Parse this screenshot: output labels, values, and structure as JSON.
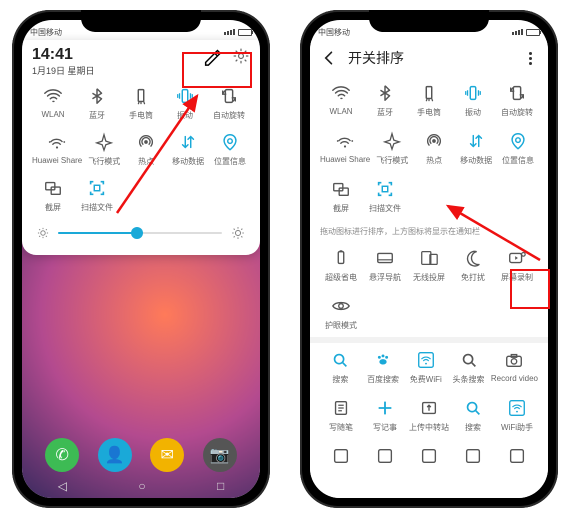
{
  "status": {
    "carrier_left": "中国移动",
    "carrier_right": "中国移动"
  },
  "left": {
    "time": "14:41",
    "date": "1月19日 星期日",
    "row1": [
      {
        "name": "wlan",
        "label": "WLAN",
        "active": false
      },
      {
        "name": "bluetooth",
        "label": "蓝牙",
        "active": false
      },
      {
        "name": "flashlight",
        "label": "手电筒",
        "active": false
      },
      {
        "name": "vibrate",
        "label": "振动",
        "active": true
      },
      {
        "name": "autorotate",
        "label": "自动旋转",
        "active": false
      }
    ],
    "row2": [
      {
        "name": "huaweishare",
        "label": "Huawei Share",
        "active": false
      },
      {
        "name": "airplane",
        "label": "飞行模式",
        "active": false
      },
      {
        "name": "hotspot",
        "label": "热点",
        "active": false
      },
      {
        "name": "mobiledata",
        "label": "移动数据",
        "active": true
      },
      {
        "name": "location",
        "label": "位置信息",
        "active": true
      }
    ],
    "row3": [
      {
        "name": "screenshot",
        "label": "截屏",
        "active": false
      },
      {
        "name": "scan",
        "label": "扫描文件",
        "active": true
      }
    ],
    "dock": [
      {
        "name": "phone",
        "color": "#3dbb54"
      },
      {
        "name": "contacts",
        "color": "#1aa9d8"
      },
      {
        "name": "messages",
        "color": "#f2b300"
      },
      {
        "name": "camera",
        "color": "#555"
      }
    ]
  },
  "right": {
    "title": "开关排序",
    "row1": [
      {
        "name": "wlan",
        "label": "WLAN",
        "active": false
      },
      {
        "name": "bluetooth",
        "label": "蓝牙",
        "active": false
      },
      {
        "name": "flashlight",
        "label": "手电筒",
        "active": false
      },
      {
        "name": "vibrate",
        "label": "振动",
        "active": true
      },
      {
        "name": "autorotate",
        "label": "自动旋转",
        "active": false
      }
    ],
    "row2": [
      {
        "name": "huaweishare",
        "label": "Huawei Share",
        "active": false
      },
      {
        "name": "airplane",
        "label": "飞行模式",
        "active": false
      },
      {
        "name": "hotspot",
        "label": "热点",
        "active": false
      },
      {
        "name": "mobiledata",
        "label": "移动数据",
        "active": true
      },
      {
        "name": "location",
        "label": "位置信息",
        "active": true
      }
    ],
    "row3": [
      {
        "name": "screenshot",
        "label": "截屏",
        "active": false
      },
      {
        "name": "scan",
        "label": "扫描文件",
        "active": true
      }
    ],
    "hint": "拖动图标进行排序，上方图标将显示在通知栏",
    "row4": [
      {
        "name": "superpower",
        "label": "超级省电"
      },
      {
        "name": "floatnav",
        "label": "悬浮导航"
      },
      {
        "name": "wirelesscast",
        "label": "无线投屏"
      },
      {
        "name": "dnd",
        "label": "免打扰"
      },
      {
        "name": "screenrecord",
        "label": "屏幕录制"
      }
    ],
    "row5": [
      {
        "name": "eyecare",
        "label": "护眼模式"
      }
    ],
    "row6": [
      {
        "name": "search",
        "label": "搜索",
        "active": true
      },
      {
        "name": "baidu",
        "label": "百度搜索",
        "active": true
      },
      {
        "name": "freewifi",
        "label": "免费WiFi",
        "active": true
      },
      {
        "name": "news",
        "label": "头条搜索"
      },
      {
        "name": "recordvideo",
        "label": "Record video"
      }
    ],
    "row7": [
      {
        "name": "writediary",
        "label": "写随笔"
      },
      {
        "name": "writenote",
        "label": "写记事",
        "active": true
      },
      {
        "name": "uploadstation",
        "label": "上传中转站"
      },
      {
        "name": "search2",
        "label": "搜索",
        "active": true
      },
      {
        "name": "wifihelper",
        "label": "WiFi助手",
        "active": true
      }
    ],
    "row8": [
      {
        "name": "misc1",
        "label": ""
      },
      {
        "name": "misc2",
        "label": ""
      },
      {
        "name": "misc3",
        "label": ""
      },
      {
        "name": "misc4",
        "label": ""
      },
      {
        "name": "misc5",
        "label": ""
      }
    ]
  }
}
